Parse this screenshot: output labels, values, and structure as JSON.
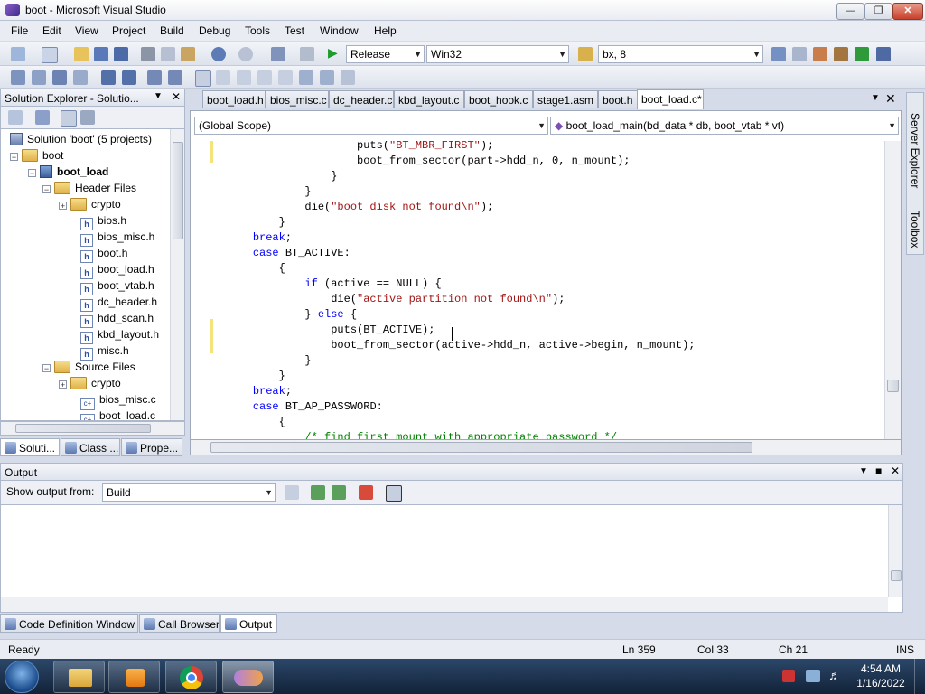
{
  "window": {
    "title": "boot - Microsoft Visual Studio",
    "minimize": "0",
    "restore": "1",
    "close": "r"
  },
  "menu": [
    "File",
    "Edit",
    "View",
    "Project",
    "Build",
    "Debug",
    "Tools",
    "Test",
    "Window",
    "Help"
  ],
  "toolbar": {
    "config": "Release",
    "platform": "Win32",
    "find": "bx, 8"
  },
  "solution_explorer": {
    "title": "Solution Explorer - Solutio...",
    "solution": "Solution 'boot' (5 projects)",
    "tree": [
      {
        "label": "boot",
        "type": "folder"
      },
      {
        "label": "boot_load",
        "type": "proj"
      },
      {
        "label": "Header Files",
        "type": "folder"
      },
      {
        "label": "crypto",
        "type": "folder"
      },
      {
        "label": "bios.h",
        "type": "h"
      },
      {
        "label": "bios_misc.h",
        "type": "h"
      },
      {
        "label": "boot.h",
        "type": "h"
      },
      {
        "label": "boot_load.h",
        "type": "h"
      },
      {
        "label": "boot_vtab.h",
        "type": "h"
      },
      {
        "label": "dc_header.h",
        "type": "h"
      },
      {
        "label": "hdd_scan.h",
        "type": "h"
      },
      {
        "label": "kbd_layout.h",
        "type": "h"
      },
      {
        "label": "misc.h",
        "type": "h"
      },
      {
        "label": "Source Files",
        "type": "folder"
      },
      {
        "label": "crypto",
        "type": "folder"
      },
      {
        "label": "bios_misc.c",
        "type": "c"
      },
      {
        "label": "boot_load.c",
        "type": "c"
      }
    ],
    "tabs": [
      "Soluti...",
      "Class ...",
      "Prope..."
    ]
  },
  "doc_tabs": [
    "boot_load.h",
    "bios_misc.c",
    "dc_header.c",
    "kbd_layout.c",
    "boot_hook.c",
    "stage1.asm",
    "boot.h",
    "boot_load.c*"
  ],
  "editor": {
    "scope": "(Global Scope)",
    "function": "boot_load_main(bd_data * db, boot_vtab * vt)",
    "lines": [
      "                    puts(\"BT_MBR_FIRST\");",
      "                    boot_from_sector(part->hdd_n, 0, n_mount);",
      "                }",
      "            }",
      "            die(\"boot disk not found\\n\");",
      "        }",
      "    break;",
      "    case BT_ACTIVE:",
      "        {",
      "            if (active == NULL) {",
      "                die(\"active partition not found\\n\");",
      "            } else {",
      "                puts(BT_ACTIVE);",
      "                boot_from_sector(active->hdd_n, active->begin, n_mount);",
      "            }",
      "        }",
      "    break;",
      "    case BT_AP_PASSWORD:",
      "        {",
      "            /* find first mount with appropriate password */"
    ]
  },
  "right_side": [
    "Server Explorer",
    "Toolbox"
  ],
  "output": {
    "title": "Output",
    "show_from_label": "Show output from:",
    "source": "Build"
  },
  "bottom_tabs": [
    "Code Definition Window",
    "Call Browser",
    "Output"
  ],
  "status": {
    "ready": "Ready",
    "ln": "Ln 359",
    "col": "Col 33",
    "ch": "Ch 21",
    "mode": "INS"
  },
  "clock": {
    "time": "4:54 AM",
    "date": "1/16/2022"
  },
  "colors": {
    "keyword": "#0000ff",
    "string": "#a31515",
    "comment": "#008000",
    "taskbar": "#1c3352"
  }
}
